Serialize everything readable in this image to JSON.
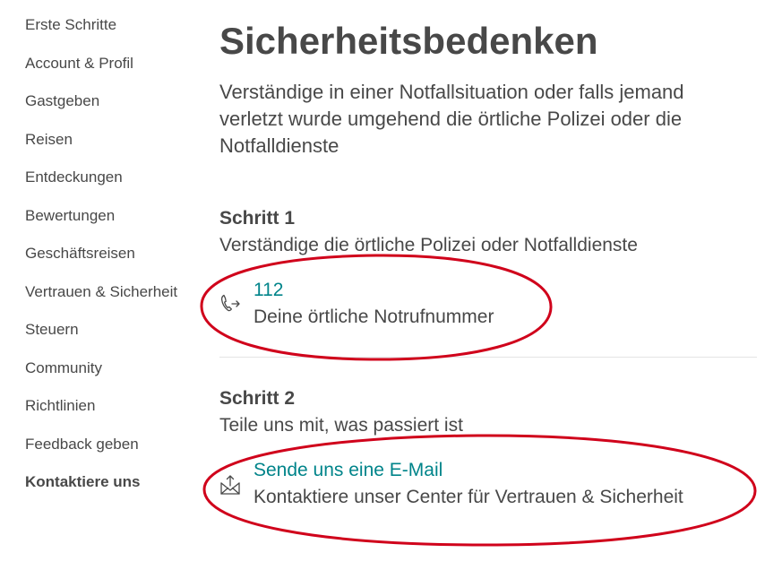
{
  "sidebar": {
    "items": [
      {
        "label": "Erste Schritte"
      },
      {
        "label": "Account & Profil"
      },
      {
        "label": "Gastgeben"
      },
      {
        "label": "Reisen"
      },
      {
        "label": "Entdeckungen"
      },
      {
        "label": "Bewertungen"
      },
      {
        "label": "Geschäftsreisen"
      },
      {
        "label": "Vertrauen & Sicherheit"
      },
      {
        "label": "Steuern"
      },
      {
        "label": "Community"
      },
      {
        "label": "Richtlinien"
      },
      {
        "label": "Feedback geben"
      },
      {
        "label": "Kontaktiere uns",
        "active": true
      }
    ]
  },
  "main": {
    "title": "Sicherheitsbedenken",
    "intro": "Verständige in einer Notfallsituation oder falls jemand verletzt wurde umgehend die örtliche Polizei oder die Notfalldienste",
    "step1": {
      "heading": "Schritt 1",
      "description": "Verständige die örtliche Polizei oder Notfalldienste",
      "contact": {
        "icon": "phone-outgoing-icon",
        "link": "112",
        "subtitle": "Deine örtliche Notrufnummer"
      }
    },
    "step2": {
      "heading": "Schritt 2",
      "description": "Teile uns mit, was passiert ist",
      "contact": {
        "icon": "email-send-icon",
        "link": "Sende uns eine E-Mail",
        "subtitle": "Kontaktiere unser Center für Vertrauen & Sicherheit"
      }
    }
  },
  "colors": {
    "text": "#484848",
    "link": "#00848a",
    "annotation": "#d0021b",
    "divider": "#e4e4e4"
  }
}
